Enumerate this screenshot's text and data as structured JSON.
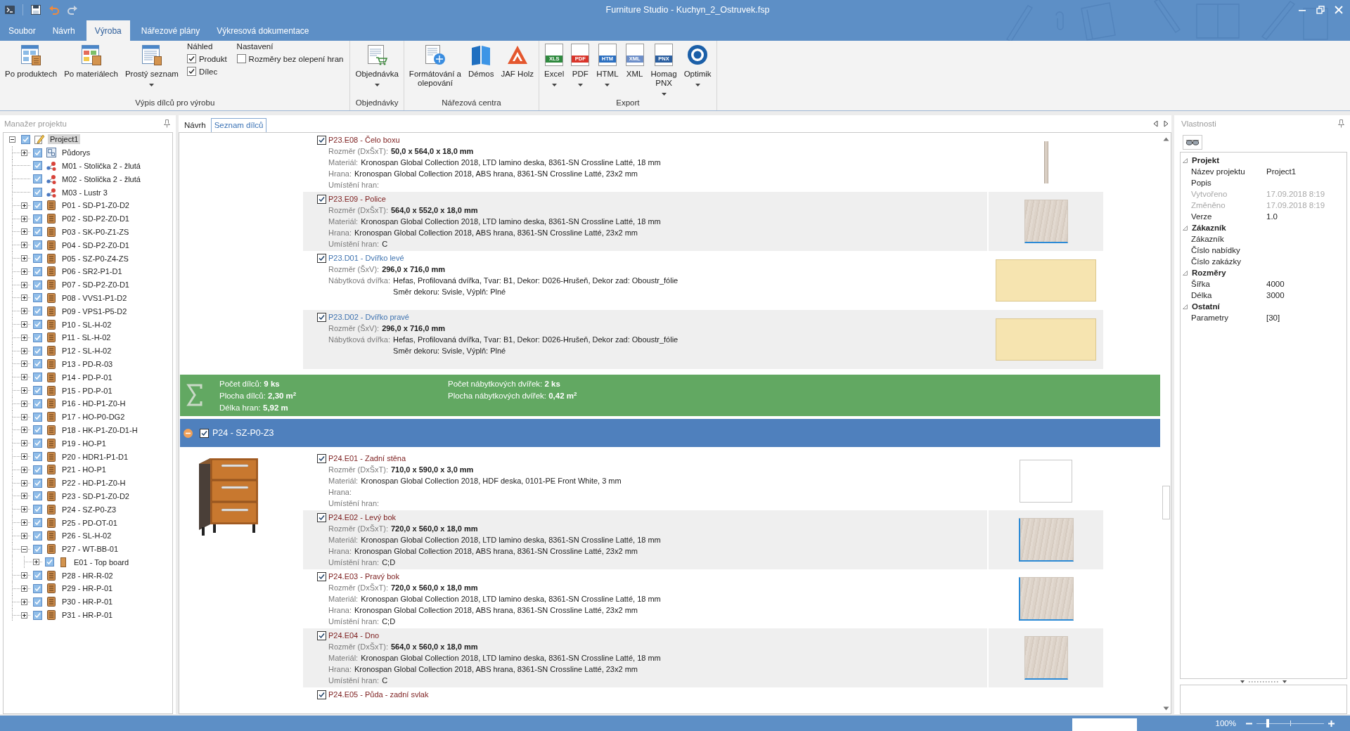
{
  "window": {
    "title": "Furniture Studio - Kuchyn_2_Ostruvek.fsp"
  },
  "ribbon": {
    "tabs": [
      {
        "label": "Soubor",
        "selected": false
      },
      {
        "label": "Návrh",
        "selected": false
      },
      {
        "label": "Výroba",
        "selected": true
      },
      {
        "label": "Nářezové plány",
        "selected": false
      },
      {
        "label": "Výkresová dokumentace",
        "selected": false
      }
    ],
    "groups": [
      {
        "title": "Výpis dílců pro výrobu",
        "controls": [
          {
            "kind": "button",
            "label": "Po produktech",
            "dropdown": false
          },
          {
            "kind": "button",
            "label": "Po materiálech",
            "dropdown": false
          },
          {
            "kind": "button",
            "label": "Prostý seznam",
            "dropdown": true
          },
          {
            "kind": "checks",
            "heading": "Náhled",
            "options": [
              {
                "label": "Produkt",
                "checked": true
              },
              {
                "label": "Dílec",
                "checked": true
              }
            ]
          },
          {
            "kind": "checks",
            "heading": "Nastavení",
            "options": [
              {
                "label": "Rozměry bez olepení hran",
                "checked": false
              }
            ]
          }
        ]
      },
      {
        "title": "Objednávky",
        "controls": [
          {
            "kind": "button",
            "label": "Objednávka",
            "dropdown": true
          }
        ]
      },
      {
        "title": "Nářezová centra",
        "controls": [
          {
            "kind": "button",
            "label": "Formátování a\nolepování",
            "dropdown": false
          },
          {
            "kind": "button",
            "label": "Démos",
            "dropdown": false
          },
          {
            "kind": "button",
            "label": "JAF Holz",
            "dropdown": false
          }
        ]
      },
      {
        "title": "Export",
        "controls": [
          {
            "kind": "button",
            "label": "Excel",
            "badge": "XLS",
            "dropdown": true
          },
          {
            "kind": "button",
            "label": "PDF",
            "badge": "PDF",
            "dropdown": true
          },
          {
            "kind": "button",
            "label": "HTML",
            "badge": "HTM",
            "dropdown": true
          },
          {
            "kind": "button",
            "label": "XML",
            "badge": "XML",
            "dropdown": false
          },
          {
            "kind": "button",
            "label": "Homag\nPNX",
            "badge": "PNX",
            "dropdown": true
          },
          {
            "kind": "button",
            "label": "Optimik",
            "dropdown": true
          }
        ]
      }
    ]
  },
  "project_manager": {
    "title": "Manažer projektu",
    "tree": [
      {
        "label": "Project1",
        "kind": "project",
        "checked": true,
        "selected": true,
        "expanded": true,
        "children": [
          {
            "label": "Půdorys",
            "kind": "floorplan",
            "checked": true,
            "selected": false,
            "expanded": false
          },
          {
            "label": "M01 - Stolička 2 - žlutá",
            "kind": "model",
            "checked": true,
            "selected": false
          },
          {
            "label": "M02 - Stolička 2 - žlutá",
            "kind": "model",
            "checked": true,
            "selected": false
          },
          {
            "label": "M03 - Lustr 3",
            "kind": "model",
            "checked": true,
            "selected": false
          },
          {
            "label": "P01 - SD-P1-Z0-D2",
            "kind": "product",
            "checked": true,
            "selected": false,
            "expanded": false
          },
          {
            "label": "P02 - SD-P2-Z0-D1",
            "kind": "product",
            "checked": true,
            "selected": false,
            "expanded": false
          },
          {
            "label": "P03 - SK-P0-Z1-ZS",
            "kind": "product",
            "checked": true,
            "selected": false,
            "expanded": false
          },
          {
            "label": "P04 - SD-P2-Z0-D1",
            "kind": "product",
            "checked": true,
            "selected": false,
            "expanded": false
          },
          {
            "label": "P05 - SZ-P0-Z4-ZS",
            "kind": "product",
            "checked": true,
            "selected": false,
            "expanded": false
          },
          {
            "label": "P06 - SR2-P1-D1",
            "kind": "product",
            "checked": true,
            "selected": false,
            "expanded": false
          },
          {
            "label": "P07 - SD-P2-Z0-D1",
            "kind": "product",
            "checked": true,
            "selected": false,
            "expanded": false
          },
          {
            "label": "P08 - VVS1-P1-D2",
            "kind": "product",
            "checked": true,
            "selected": false,
            "expanded": false
          },
          {
            "label": "P09 - VPS1-P5-D2",
            "kind": "product",
            "checked": true,
            "selected": false,
            "expanded": false
          },
          {
            "label": "P10 - SL-H-02",
            "kind": "product",
            "checked": true,
            "selected": false,
            "expanded": false
          },
          {
            "label": "P11 - SL-H-02",
            "kind": "product",
            "checked": true,
            "selected": false,
            "expanded": false
          },
          {
            "label": "P12 - SL-H-02",
            "kind": "product",
            "checked": true,
            "selected": false,
            "expanded": false
          },
          {
            "label": "P13 - PD-R-03",
            "kind": "product",
            "checked": true,
            "selected": false,
            "expanded": false
          },
          {
            "label": "P14 - PD-P-01",
            "kind": "product",
            "checked": true,
            "selected": false,
            "expanded": false
          },
          {
            "label": "P15 - PD-P-01",
            "kind": "product",
            "checked": true,
            "selected": false,
            "expanded": false
          },
          {
            "label": "P16 - HD-P1-Z0-H",
            "kind": "product",
            "checked": true,
            "selected": false,
            "expanded": false
          },
          {
            "label": "P17 - HO-P0-DG2",
            "kind": "product",
            "checked": true,
            "selected": false,
            "expanded": false
          },
          {
            "label": "P18 - HK-P1-Z0-D1-H",
            "kind": "product",
            "checked": true,
            "selected": false,
            "expanded": false
          },
          {
            "label": "P19 - HO-P1",
            "kind": "product",
            "checked": true,
            "selected": false,
            "expanded": false
          },
          {
            "label": "P20 - HDR1-P1-D1",
            "kind": "product",
            "checked": true,
            "selected": false,
            "expanded": false
          },
          {
            "label": "P21 - HO-P1",
            "kind": "product",
            "checked": true,
            "selected": false,
            "expanded": false
          },
          {
            "label": "P22 - HD-P1-Z0-H",
            "kind": "product",
            "checked": true,
            "selected": false,
            "expanded": false
          },
          {
            "label": "P23 - SD-P1-Z0-D2",
            "kind": "product",
            "checked": true,
            "selected": false,
            "expanded": false
          },
          {
            "label": "P24 - SZ-P0-Z3",
            "kind": "product",
            "checked": true,
            "selected": false,
            "expanded": false
          },
          {
            "label": "P25 - PD-OT-01",
            "kind": "product",
            "checked": true,
            "selected": false,
            "expanded": false
          },
          {
            "label": "P26 - SL-H-02",
            "kind": "product",
            "checked": true,
            "selected": false,
            "expanded": false
          },
          {
            "label": "P27 - WT-BB-01",
            "kind": "product",
            "checked": true,
            "selected": false,
            "expanded": true,
            "children": [
              {
                "label": "E01 - Top board",
                "kind": "board",
                "checked": true,
                "selected": false,
                "expanded": false
              }
            ]
          },
          {
            "label": "P28 - HR-R-02",
            "kind": "product",
            "checked": true,
            "selected": false,
            "expanded": false
          },
          {
            "label": "P29 - HR-P-01",
            "kind": "product",
            "checked": true,
            "selected": false,
            "expanded": false
          },
          {
            "label": "P30 - HR-P-01",
            "kind": "product",
            "checked": true,
            "selected": false,
            "expanded": false
          },
          {
            "label": "P31 - HR-P-01",
            "kind": "product",
            "checked": true,
            "selected": false,
            "expanded": false
          }
        ]
      }
    ]
  },
  "document_tabs": [
    {
      "label": "Návrh",
      "selected": false
    },
    {
      "label": "Seznam dílců",
      "selected": true
    }
  ],
  "parts_list": {
    "sections": [
      {
        "kind": "parts",
        "items": [
          {
            "kind": "panel",
            "title": "P23.E08 - Čelo boxu",
            "checked": true,
            "thumbnail": {
              "kind": "strip"
            },
            "fields": [
              {
                "kind": "dimension",
                "label": "Rozměr (DxŠxT):",
                "value": "50,0 x 564,0 x 18,0 mm"
              },
              {
                "kind": "text",
                "label": "Materiál:",
                "value": "Kronospan Global Collection 2018, LTD lamino deska, 8361-SN Crossline Latté, 18 mm"
              },
              {
                "kind": "text",
                "label": "Hrana:",
                "value": "Kronospan Global Collection 2018, ABS hrana, 8361-SN Crossline Latté, 23x2 mm"
              },
              {
                "label": "Umístění hran:"
              }
            ]
          },
          {
            "kind": "panel",
            "title": "P23.E09 - Police",
            "checked": true,
            "thumbnail": {
              "kind": "board",
              "edge_left": false,
              "edge_bottom": true
            },
            "fields": [
              {
                "kind": "dimension",
                "label": "Rozměr (DxŠxT):",
                "value": "564,0 x 552,0 x 18,0 mm"
              },
              {
                "kind": "text",
                "label": "Materiál:",
                "value": "Kronospan Global Collection 2018, LTD lamino deska, 8361-SN Crossline Latté, 18 mm"
              },
              {
                "kind": "text",
                "label": "Hrana:",
                "value": "Kronospan Global Collection 2018, ABS hrana, 8361-SN Crossline Latté, 23x2 mm"
              },
              {
                "kind": "text",
                "label": "Umístění hran:",
                "value": "C"
              }
            ]
          },
          {
            "kind": "door",
            "title": "P23.D01 - Dvířko levé",
            "checked": true,
            "thumbnail": {
              "kind": "door"
            },
            "fields": [
              {
                "kind": "dimension",
                "label": "Rozměr (ŠxV):",
                "value": "296,0 x 716,0 mm"
              },
              {
                "kind": "text",
                "label": "Nábytková dvířka:",
                "value": "Hefas, Profilovaná dvířka, Tvar: B1, Dekor: D026-Hrušeň, Dekor zad: Oboustr_fólie",
                "continuation": "Směr dekoru: Svisle, Výplň: Plné"
              }
            ]
          },
          {
            "kind": "door",
            "title": "P23.D02 - Dvířko pravé",
            "checked": true,
            "thumbnail": {
              "kind": "door"
            },
            "fields": [
              {
                "kind": "dimension",
                "label": "Rozměr (ŠxV):",
                "value": "296,0 x 716,0 mm"
              },
              {
                "kind": "text",
                "label": "Nábytková dvířka:",
                "value": "Hefas, Profilovaná dvířka, Tvar: B1, Dekor: D026-Hrušeň, Dekor zad: Oboustr_fólie",
                "continuation": "Směr dekoru: Svisle, Výplň: Plné"
              }
            ]
          }
        ]
      },
      {
        "kind": "summary",
        "left": [
          "Počet dílců: **9 ks**",
          "Plocha dílců: **2,30 m**$^{2}$",
          "Délka hran: **5,92 m**"
        ],
        "right": [
          "Počet nábytkových dvířek: **2 ks**",
          "Plocha nábytkových dvířek: **0,42 m**$^{2}$"
        ]
      },
      {
        "kind": "product",
        "title": "P24 - SZ-P0-Z3",
        "checked": true,
        "expanded": true,
        "items": [
          {
            "kind": "panel",
            "title": "P24.E01 - Zadní stěna",
            "checked": true,
            "thumbnail": {
              "kind": "blank"
            },
            "fields": [
              {
                "kind": "dimension",
                "label": "Rozměr (DxŠxT):",
                "value": "710,0 x 590,0 x 3,0 mm"
              },
              {
                "kind": "text",
                "label": "Materiál:",
                "value": "Kronospan Global Collection 2018, HDF deska, 0101-PE Front White, 3 mm"
              },
              {
                "label": "Hrana:"
              },
              {
                "label": "Umístění hran:"
              }
            ]
          },
          {
            "kind": "panel",
            "title": "P24.E02 - Levý bok",
            "checked": true,
            "thumbnail": {
              "kind": "board",
              "edge_left": true,
              "edge_bottom": true
            },
            "fields": [
              {
                "kind": "dimension",
                "label": "Rozměr (DxŠxT):",
                "value": "720,0 x 560,0 x 18,0 mm"
              },
              {
                "kind": "text",
                "label": "Materiál:",
                "value": "Kronospan Global Collection 2018, LTD lamino deska, 8361-SN Crossline Latté, 18 mm"
              },
              {
                "kind": "text",
                "label": "Hrana:",
                "value": "Kronospan Global Collection 2018, ABS hrana, 8361-SN Crossline Latté, 23x2 mm"
              },
              {
                "kind": "text",
                "label": "Umístění hran:",
                "value": "C;D"
              }
            ]
          },
          {
            "kind": "panel",
            "title": "P24.E03 - Pravý bok",
            "checked": true,
            "thumbnail": {
              "kind": "board",
              "edge_left": true,
              "edge_bottom": true
            },
            "fields": [
              {
                "kind": "dimension",
                "label": "Rozměr (DxŠxT):",
                "value": "720,0 x 560,0 x 18,0 mm"
              },
              {
                "kind": "text",
                "label": "Materiál:",
                "value": "Kronospan Global Collection 2018, LTD lamino deska, 8361-SN Crossline Latté, 18 mm"
              },
              {
                "kind": "text",
                "label": "Hrana:",
                "value": "Kronospan Global Collection 2018, ABS hrana, 8361-SN Crossline Latté, 23x2 mm"
              },
              {
                "kind": "text",
                "label": "Umístění hran:",
                "value": "C;D"
              }
            ]
          },
          {
            "kind": "panel",
            "title": "P24.E04 - Dno",
            "checked": true,
            "thumbnail": {
              "kind": "board",
              "edge_left": false,
              "edge_bottom": true
            },
            "fields": [
              {
                "kind": "dimension",
                "label": "Rozměr (DxŠxT):",
                "value": "564,0 x 560,0 x 18,0 mm"
              },
              {
                "kind": "text",
                "label": "Materiál:",
                "value": "Kronospan Global Collection 2018, LTD lamino deska, 8361-SN Crossline Latté, 18 mm"
              },
              {
                "kind": "text",
                "label": "Hrana:",
                "value": "Kronospan Global Collection 2018, ABS hrana, 8361-SN Crossline Latté, 23x2 mm"
              },
              {
                "kind": "text",
                "label": "Umístění hran:",
                "value": "C"
              }
            ]
          },
          {
            "kind": "panel",
            "title": "P24.E05 - Půda - zadní svlak",
            "checked": true
          }
        ]
      }
    ]
  },
  "properties": {
    "title": "Vlastnosti",
    "categories": [
      {
        "name": "Projekt",
        "expanded": true,
        "rows": [
          {
            "name": "Název projektu",
            "value": "Project1",
            "disabled": false
          },
          {
            "name": "Popis",
            "disabled": false
          },
          {
            "name": "Vytvořeno",
            "value": "17.09.2018 8:19",
            "disabled": true
          },
          {
            "name": "Změněno",
            "value": "17.09.2018 8:19",
            "disabled": true
          },
          {
            "name": "Verze",
            "value": "1.0",
            "disabled": false
          }
        ]
      },
      {
        "name": "Zákazník",
        "expanded": true,
        "rows": [
          {
            "name": "Zákazník",
            "disabled": false
          },
          {
            "name": "Číslo nabídky",
            "disabled": false
          },
          {
            "name": "Číslo zakázky",
            "disabled": false
          }
        ]
      },
      {
        "name": "Rozměry",
        "expanded": true,
        "rows": [
          {
            "name": "Šířka",
            "value": "4000",
            "disabled": false
          },
          {
            "name": "Délka",
            "value": "3000",
            "disabled": false
          }
        ]
      },
      {
        "name": "Ostatní",
        "expanded": true,
        "rows": [
          {
            "name": "Parametry",
            "value": "[30]",
            "disabled": false
          }
        ]
      }
    ]
  },
  "status_bar": {
    "zoom": "100%",
    "zoom_slider": {
      "level": 0.17
    }
  }
}
